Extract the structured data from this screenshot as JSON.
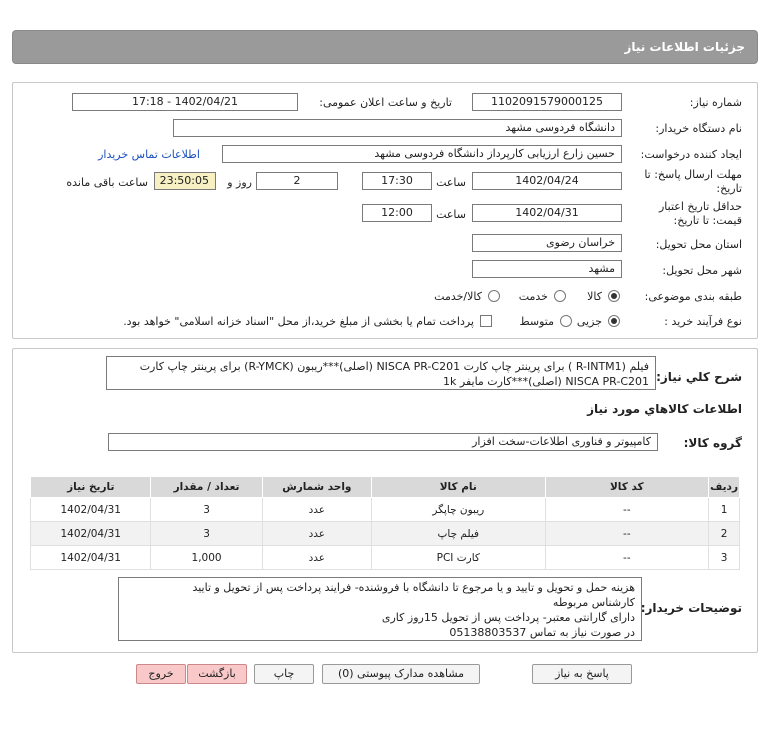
{
  "title": "جزئیات اطلاعات نیاز",
  "fields": {
    "need_number_label": "شماره نیاز:",
    "need_number": "1102091579000125",
    "announce_label": "تاریخ و ساعت اعلان عمومی:",
    "announce_value": "1402/04/21 - 17:18",
    "buyer_org_label": "نام دستگاه خریدار:",
    "buyer_org": "دانشگاه فردوسی مشهد",
    "requester_label": "ایجاد کننده درخواست:",
    "requester": "حسین زارع ارزیابی کارپرداز دانشگاه فردوسی مشهد",
    "contact_link": "اطلاعات تماس خریدار",
    "deadline_label_1": "مهلت ارسال پاسخ: تا",
    "deadline_label_2": "تاریخ:",
    "deadline_date": "1402/04/24",
    "time_word": "ساعت",
    "deadline_time": "17:30",
    "days_value": "2",
    "days_word": "روز و",
    "remaining_time": "23:50:05",
    "remaining_word": "ساعت باقی مانده",
    "validity_label_1": "حداقل تاریخ اعتبار",
    "validity_label_2": "قیمت: تا تاریخ:",
    "validity_date": "1402/04/31",
    "validity_time": "12:00",
    "province_label": "استان محل تحویل:",
    "province": "خراسان رضوی",
    "city_label": "شهر محل تحویل:",
    "city": "مشهد",
    "category_label": "طبقه بندی موضوعی:",
    "category_options": [
      "کالا",
      "خدمت",
      "کالا/خدمت"
    ],
    "purchase_label": "نوع فرآیند خرید :",
    "purchase_options": [
      "جزیی",
      "متوسط"
    ],
    "treasury_note": "پرداخت تمام یا بخشی از مبلغ خرید،از محل \"اسناد خزانه اسلامی\" خواهد بود."
  },
  "summary": {
    "label": "شرح کلي نياز:",
    "line1": "فیلم (R-INTM1 ) برای پرینتر چاپ کارت NISCA PR-C201 (اصلی)***ریبون (R-YMCK) برای پرینتر چاپ کارت",
    "line2": "NISCA PR-C201 (اصلی)***کارت مایفر 1k"
  },
  "goods_section": {
    "heading": "اطلاعات کالاهاي مورد نياز",
    "group_label": "گروه کالا:",
    "group_value": "کامپیوتر و فناوری اطلاعات-سخت افزار"
  },
  "table": {
    "headers": [
      "ردیف",
      "کد کالا",
      "نام کالا",
      "واحد شمارش",
      "تعداد / مقدار",
      "تاریخ نیاز"
    ],
    "rows": [
      [
        "1",
        "--",
        "ریبون چاپگر",
        "عدد",
        "3",
        "1402/04/31"
      ],
      [
        "2",
        "--",
        "فیلم چاپ",
        "عدد",
        "3",
        "1402/04/31"
      ],
      [
        "3",
        "--",
        "کارت PCI",
        "عدد",
        "1,000",
        "1402/04/31"
      ]
    ]
  },
  "buyer_notes": {
    "label": "توضیحات خریدار:",
    "lines": [
      "هزینه حمل و تحویل و تایید و یا مرجوع تا دانشگاه با فروشنده- فرایند پرداخت پس از تحویل و تایید",
      "کارشناس مربوطه",
      "دارای گارانتی معتبر- پرداخت پس از تحویل 15روز کاری",
      "در صورت نیاز به تماس 05138803537"
    ]
  },
  "buttons": {
    "reply": "پاسخ به نیاز",
    "attachments": "مشاهده مدارک پیوستی (0)",
    "print": "چاپ",
    "back": "بازگشت",
    "exit": "خروج"
  }
}
